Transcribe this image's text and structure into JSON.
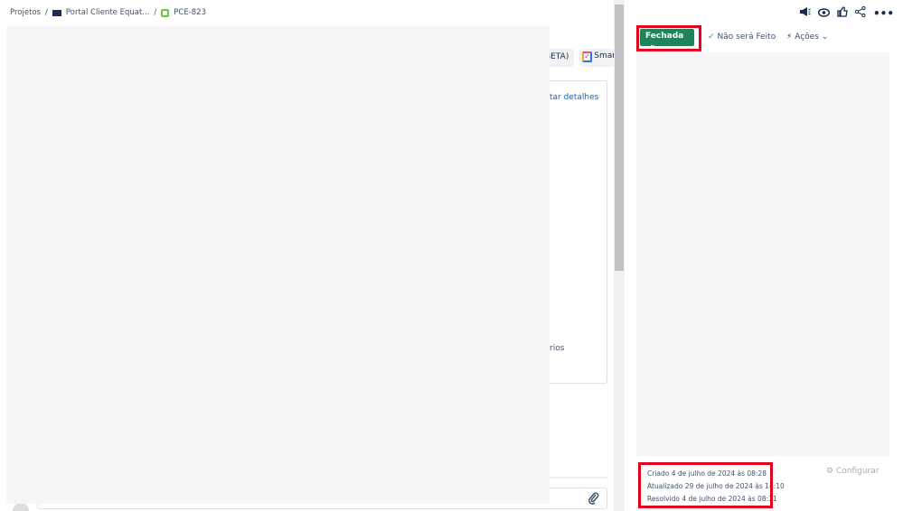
{
  "breadcrumb": {
    "projects": "Projetos",
    "sep": "/",
    "project": "Portal Cliente Equat...",
    "issue_key": "PCE-823"
  },
  "main": {
    "beta_button": "BETA)",
    "smart_button": "Smar",
    "details_link": "tar detalhes",
    "partial_text": "rios"
  },
  "header_icons": [
    "megaphone-icon",
    "eye-icon",
    "thumbs-up-icon",
    "share-icon",
    "more-icon"
  ],
  "status": {
    "label": "Fechada",
    "resolution": "Não será Feito",
    "actions": "Ações",
    "color": "#1f845a"
  },
  "dates": {
    "created": "Criado 4 de julho de 2024 às 08:28",
    "updated": "Atualizado 29 de julho de 2024 às 14:10",
    "resolved": "Resolvido 4 de julho de 2024 às 08:31"
  },
  "configure": "Configurar"
}
